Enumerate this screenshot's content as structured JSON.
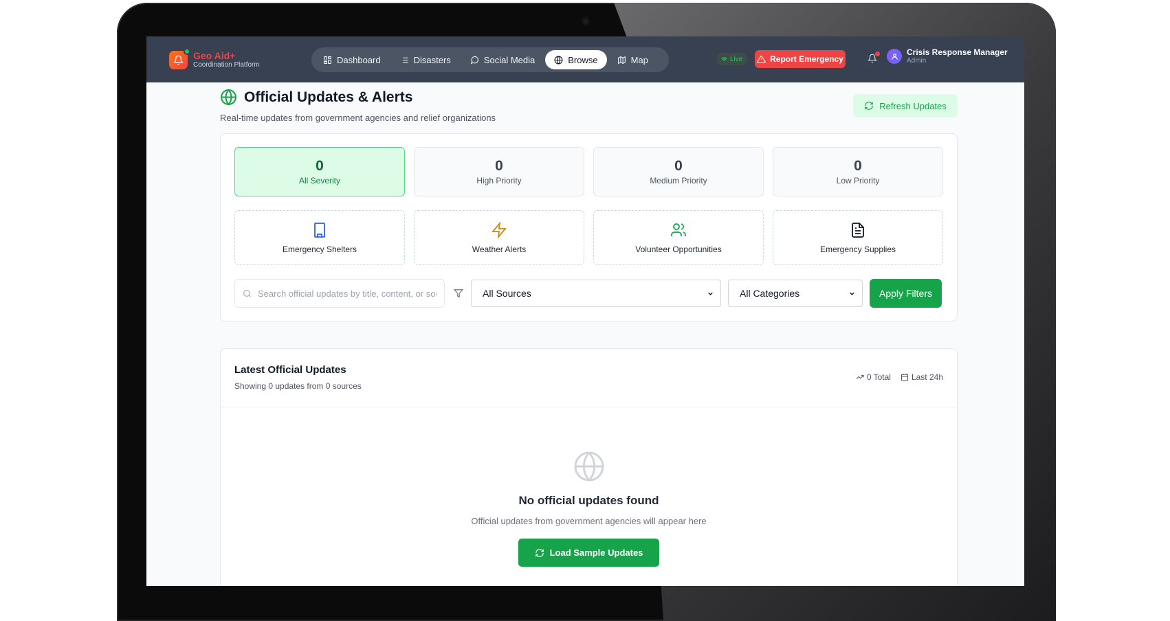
{
  "brand": {
    "name": "Geo Aid+",
    "subtitle": "Coordination Platform"
  },
  "nav": {
    "items": [
      {
        "label": "Dashboard",
        "icon": "grid-icon"
      },
      {
        "label": "Disasters",
        "icon": "list-icon"
      },
      {
        "label": "Social Media",
        "icon": "chat-bubble-icon"
      },
      {
        "label": "Browse",
        "icon": "globe-icon",
        "active": true
      },
      {
        "label": "Map",
        "icon": "map-icon"
      }
    ]
  },
  "header": {
    "live_label": "Live",
    "report_label": "Report Emergency",
    "user_name": "Crisis Response Manager",
    "user_role": "Admin"
  },
  "page": {
    "title": "Official Updates & Alerts",
    "subtitle": "Real-time updates from government agencies and relief organizations",
    "refresh_label": "Refresh Updates"
  },
  "severity": [
    {
      "count": "0",
      "label": "All Severity",
      "active": true
    },
    {
      "count": "0",
      "label": "High Priority"
    },
    {
      "count": "0",
      "label": "Medium Priority"
    },
    {
      "count": "0",
      "label": "Low Priority"
    }
  ],
  "categories": [
    {
      "label": "Emergency Shelters",
      "icon": "building-icon",
      "color": "#2563eb"
    },
    {
      "label": "Weather Alerts",
      "icon": "lightning-icon",
      "color": "#ca8a04"
    },
    {
      "label": "Volunteer Opportunities",
      "icon": "users-icon",
      "color": "#16a34a"
    },
    {
      "label": "Emergency Supplies",
      "icon": "document-icon",
      "color": "#111827"
    }
  ],
  "filters": {
    "search_placeholder": "Search official updates by title, content, or source...",
    "search_value": "",
    "sources_value": "All Sources",
    "categories_value": "All Categories",
    "apply_label": "Apply Filters"
  },
  "updates": {
    "title": "Latest Official Updates",
    "subtitle": "Showing 0 updates from 0 sources",
    "total_label": "0 Total",
    "window_label": "Last 24h",
    "empty_title": "No official updates found",
    "empty_subtitle": "Official updates from government agencies will appear here",
    "load_label": "Load Sample Updates"
  },
  "colors": {
    "navbar": "#374151",
    "accent_green": "#16a34a",
    "danger_red": "#ef4444",
    "brand_orange": "#f97316"
  }
}
